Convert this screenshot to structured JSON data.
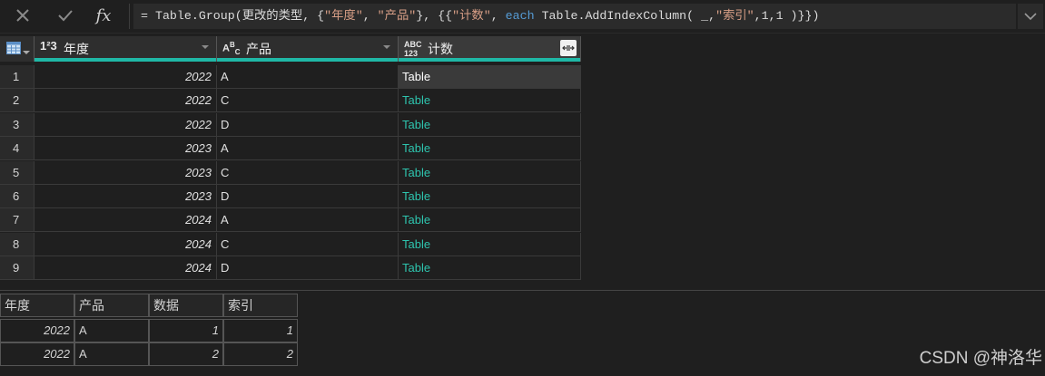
{
  "formula_bar": {
    "fx_label": "fx",
    "prefix": "= Table.Group(更改的类型, {",
    "str1": "\"年度\"",
    "sep1": ", ",
    "str2": "\"产品\"",
    "mid1": "}, {{",
    "str3": "\"计数\"",
    "sep2": ", ",
    "kw_each": "each",
    "mid2": " Table.AddIndexColumn( _,",
    "str4": "\"索引\"",
    "suffix": ",1,1 )}})"
  },
  "grid": {
    "columns": [
      {
        "label": "年度",
        "type_icon": "1²3"
      },
      {
        "label": "产品",
        "type_icon": "ABC"
      },
      {
        "label": "计数",
        "type_icon": "ABC123"
      }
    ],
    "rows": [
      {
        "idx": "1",
        "year": "2022",
        "product": "A",
        "count": "Table"
      },
      {
        "idx": "2",
        "year": "2022",
        "product": "C",
        "count": "Table"
      },
      {
        "idx": "3",
        "year": "2022",
        "product": "D",
        "count": "Table"
      },
      {
        "idx": "4",
        "year": "2023",
        "product": "A",
        "count": "Table"
      },
      {
        "idx": "5",
        "year": "2023",
        "product": "C",
        "count": "Table"
      },
      {
        "idx": "6",
        "year": "2023",
        "product": "D",
        "count": "Table"
      },
      {
        "idx": "7",
        "year": "2024",
        "product": "A",
        "count": "Table"
      },
      {
        "idx": "8",
        "year": "2024",
        "product": "C",
        "count": "Table"
      },
      {
        "idx": "9",
        "year": "2024",
        "product": "D",
        "count": "Table"
      }
    ]
  },
  "preview": {
    "headers": [
      "年度",
      "产品",
      "数据",
      "索引"
    ],
    "rows": [
      [
        "2022",
        "A",
        "1",
        "1"
      ],
      [
        "2022",
        "A",
        "2",
        "2"
      ]
    ]
  },
  "watermark": "CSDN @神洛华",
  "colors": {
    "accent": "#1fb8a6",
    "link": "#2ec4ae",
    "string": "#d69d85",
    "keyword": "#569cd6"
  }
}
